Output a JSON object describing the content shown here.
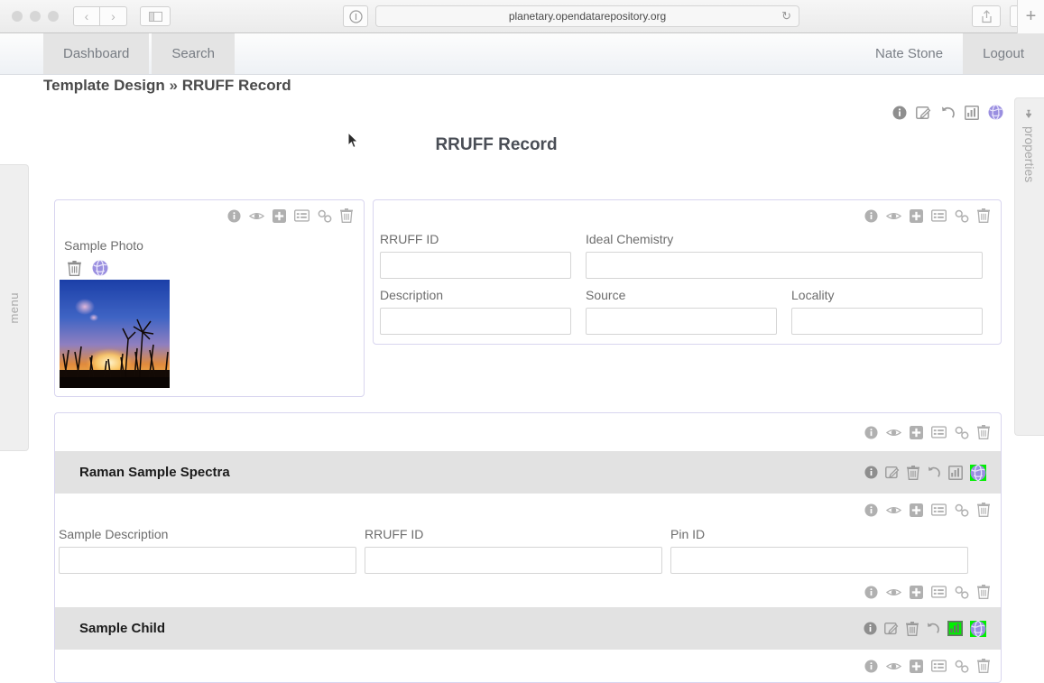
{
  "browser": {
    "url": "planetary.opendatarepository.org",
    "back_label": "‹",
    "forward_label": "›",
    "reload_label": "↻",
    "new_tab_label": "+"
  },
  "nav": {
    "tabs": [
      {
        "label": "Dashboard",
        "name": "nav-tab-dashboard"
      },
      {
        "label": "Search",
        "name": "nav-tab-search"
      }
    ],
    "user": "Nate Stone",
    "logout": "Logout"
  },
  "breadcrumb": {
    "root": "Template Design",
    "separator": "»",
    "current": "RRUFF Record"
  },
  "side_tabs": {
    "menu": "menu",
    "properties": "properties"
  },
  "page": {
    "title": "RRUFF Record"
  },
  "top_toolbar": {
    "icons": [
      "info-icon",
      "edit-icon",
      "undo-icon",
      "chart-icon",
      "globe-icon"
    ]
  },
  "photo_card": {
    "icons": [
      "info-icon",
      "eye-icon",
      "plus-icon",
      "list-icon",
      "link-icon",
      "trash-icon"
    ],
    "label": "Sample Photo",
    "actions": [
      "trash-icon",
      "globe-icon"
    ]
  },
  "fields_card": {
    "icons": [
      "info-icon",
      "eye-icon",
      "plus-icon",
      "list-icon",
      "link-icon",
      "trash-icon"
    ],
    "row1": [
      {
        "label": "RRUFF ID",
        "value": "",
        "placeholder": ""
      },
      {
        "label": "Ideal Chemistry",
        "value": "",
        "placeholder": ""
      }
    ],
    "row2": [
      {
        "label": "Description",
        "value": "",
        "placeholder": ""
      },
      {
        "label": "Source",
        "value": "",
        "placeholder": ""
      },
      {
        "label": "Locality",
        "value": "",
        "placeholder": ""
      }
    ]
  },
  "section": {
    "top_icons": [
      "info-icon",
      "eye-icon",
      "plus-icon",
      "list-icon",
      "link-icon",
      "trash-icon"
    ],
    "raman": {
      "title": "Raman Sample Spectra",
      "icons": [
        {
          "name": "info-icon",
          "highlighted": false
        },
        {
          "name": "edit-icon",
          "highlighted": false
        },
        {
          "name": "trash-icon",
          "highlighted": false
        },
        {
          "name": "undo-icon",
          "highlighted": false
        },
        {
          "name": "chart-icon",
          "highlighted": false
        },
        {
          "name": "globe-icon",
          "highlighted": true
        }
      ]
    },
    "mid_icons": [
      "info-icon",
      "eye-icon",
      "plus-icon",
      "list-icon",
      "link-icon",
      "trash-icon"
    ],
    "fields": [
      {
        "label": "Sample Description",
        "value": "",
        "placeholder": ""
      },
      {
        "label": "RRUFF ID",
        "value": "",
        "placeholder": ""
      },
      {
        "label": "Pin ID",
        "value": "",
        "placeholder": ""
      }
    ],
    "child_top_icons": [
      "info-icon",
      "eye-icon",
      "plus-icon",
      "list-icon",
      "link-icon",
      "trash-icon"
    ],
    "child": {
      "title": "Sample Child",
      "icons": [
        {
          "name": "info-icon",
          "highlighted": false
        },
        {
          "name": "edit-icon",
          "highlighted": false
        },
        {
          "name": "trash-icon",
          "highlighted": false
        },
        {
          "name": "undo-icon",
          "highlighted": false
        },
        {
          "name": "chart-icon",
          "highlighted": true
        },
        {
          "name": "globe-icon",
          "highlighted": true
        }
      ]
    },
    "bottom_icons": [
      "info-icon",
      "eye-icon",
      "plus-icon",
      "list-icon",
      "link-icon",
      "trash-icon"
    ]
  },
  "colors": {
    "card_border": "#d8d5ef",
    "section_header_bg": "#e2e2e2",
    "highlight_green": "#00f000",
    "globe_purple": "#9a8fe0",
    "icon_gray": "#9b9b9b",
    "label_gray": "#6d6d6d"
  }
}
